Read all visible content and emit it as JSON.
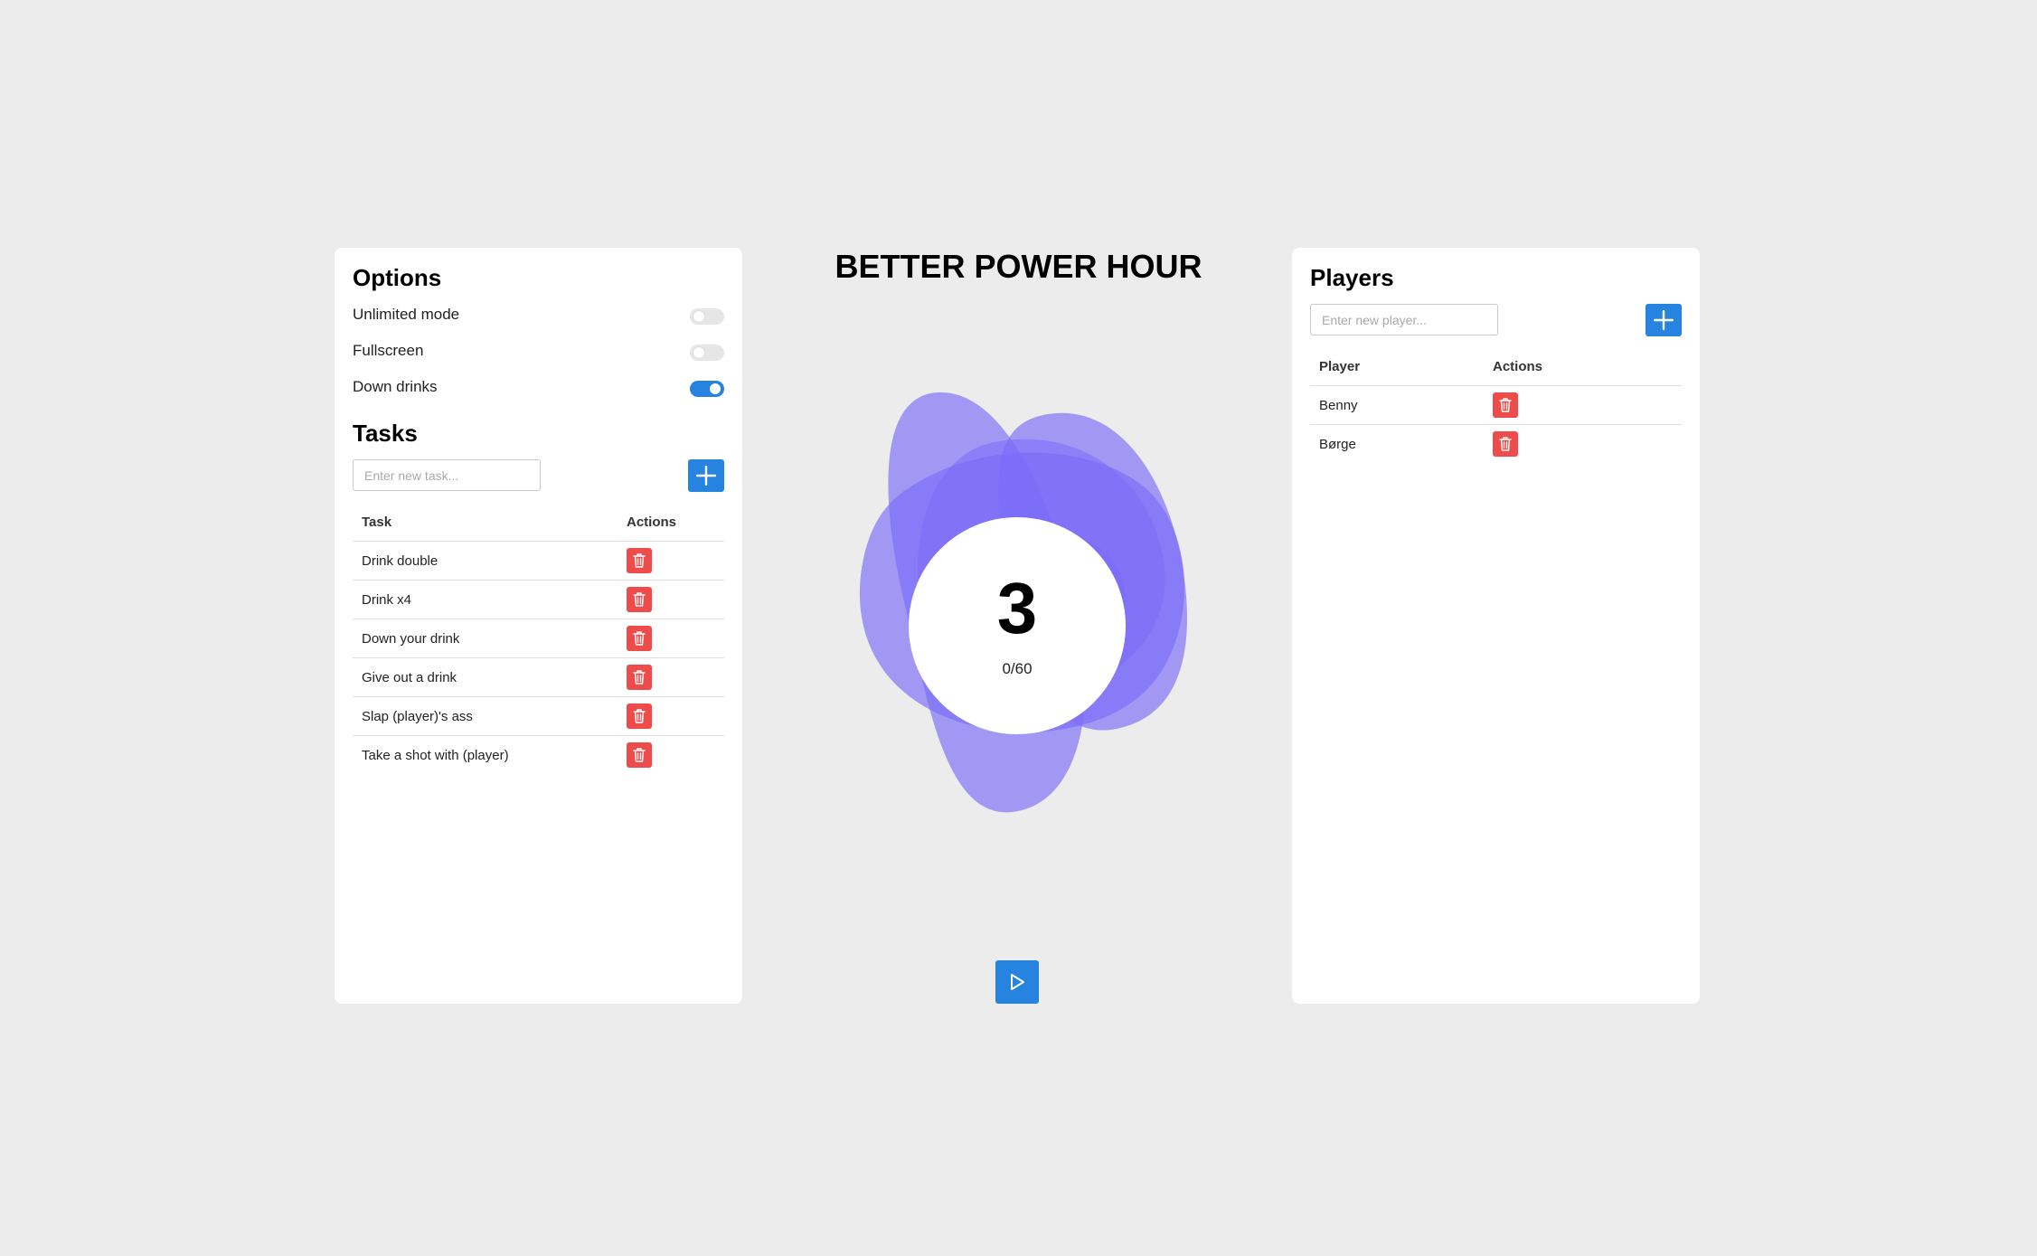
{
  "app": {
    "title": "BETTER POWER HOUR"
  },
  "options": {
    "title": "Options",
    "items": [
      {
        "label": "Unlimited mode",
        "enabled": false
      },
      {
        "label": "Fullscreen",
        "enabled": false
      },
      {
        "label": "Down drinks",
        "enabled": true
      }
    ]
  },
  "tasks": {
    "title": "Tasks",
    "input_placeholder": "Enter new task...",
    "headers": {
      "name": "Task",
      "actions": "Actions"
    },
    "items": [
      "Drink double",
      "Drink x4",
      "Down your drink",
      "Give out a drink",
      "Slap (player)'s ass",
      "Take a shot with (player)"
    ]
  },
  "players": {
    "title": "Players",
    "input_placeholder": "Enter new player...",
    "headers": {
      "name": "Player",
      "actions": "Actions"
    },
    "items": [
      "Benny",
      "Børge"
    ]
  },
  "timer": {
    "count": "3",
    "progress_text": "0/60",
    "completed": 0,
    "total": 60
  },
  "icons": {
    "add": "plus-icon",
    "delete": "trash-icon",
    "play": "play-icon"
  },
  "colors": {
    "background": "#ececec",
    "panel": "#ffffff",
    "accent": "#2684e0",
    "danger": "#ee4b4b",
    "blob": "#7b6cf9"
  }
}
